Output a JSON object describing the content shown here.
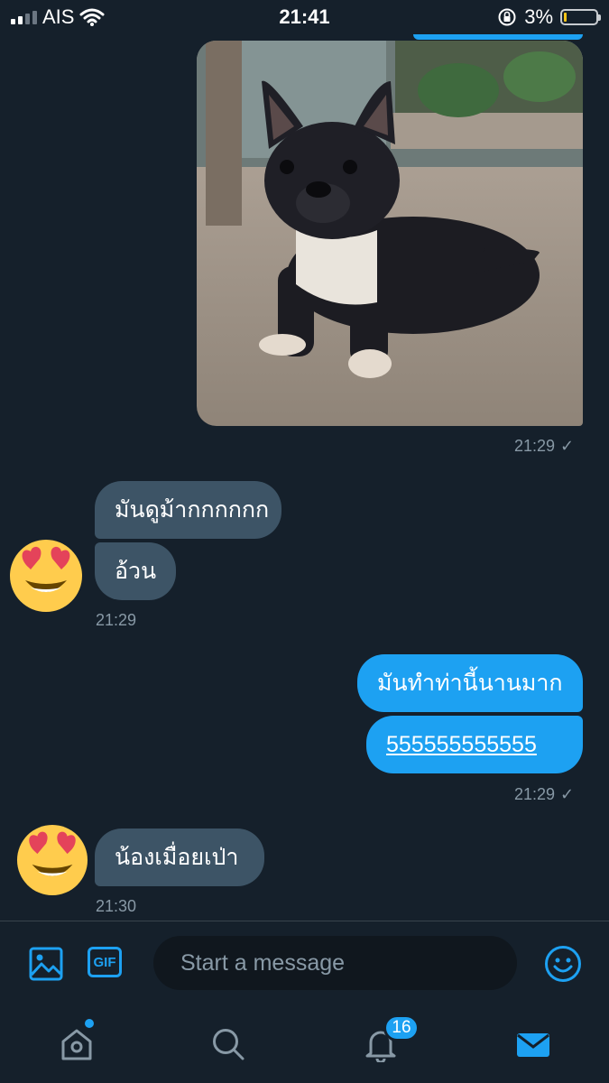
{
  "status_bar": {
    "carrier": "AIS",
    "time": "21:41",
    "battery_percent": "3%",
    "battery_level": 0.03,
    "signal_bars": 2
  },
  "messages": [
    {
      "type": "image",
      "direction": "sent",
      "description_icon": "photo-image"
    },
    {
      "type": "timestamp",
      "direction": "sent",
      "text": "21:29",
      "read_icon": "check-icon"
    },
    {
      "type": "text",
      "direction": "received",
      "text": "มันดูม้ากกกกกก"
    },
    {
      "type": "text",
      "direction": "received",
      "text": "อ้วน"
    },
    {
      "type": "timestamp",
      "direction": "received",
      "text": "21:29"
    },
    {
      "type": "text",
      "direction": "sent",
      "text": "มันทำท่านี้นานมาก"
    },
    {
      "type": "text",
      "direction": "sent",
      "text": "555555555555"
    },
    {
      "type": "timestamp",
      "direction": "sent",
      "text": "21:29",
      "read_icon": "check-icon"
    },
    {
      "type": "text",
      "direction": "received",
      "text": "น้องเมื่อยเป่า"
    },
    {
      "type": "timestamp",
      "direction": "received",
      "text": "21:30"
    }
  ],
  "avatar_emoji": "smiling-face-with-heart-eyes",
  "composer": {
    "placeholder": "Start a message",
    "gif_label": "GIF"
  },
  "nav": {
    "notifications_badge": "16"
  },
  "colors": {
    "background": "#15202b",
    "accent": "#1da1f2",
    "incoming_bubble": "#3d5466",
    "muted_text": "#8899a6"
  }
}
